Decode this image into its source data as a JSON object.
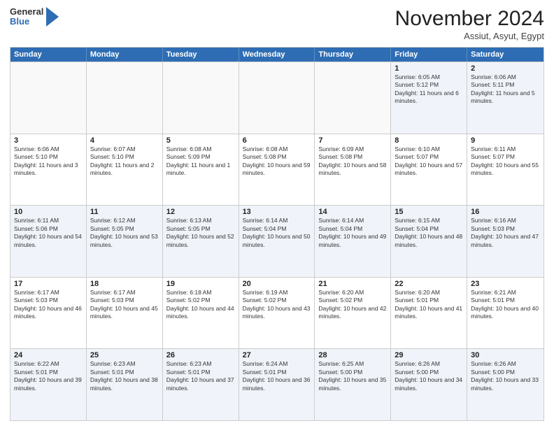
{
  "header": {
    "logo_general": "General",
    "logo_blue": "Blue",
    "month_title": "November 2024",
    "location": "Assiut, Asyut, Egypt"
  },
  "days_of_week": [
    "Sunday",
    "Monday",
    "Tuesday",
    "Wednesday",
    "Thursday",
    "Friday",
    "Saturday"
  ],
  "rows": [
    [
      {
        "day": "",
        "text": "",
        "empty": true
      },
      {
        "day": "",
        "text": "",
        "empty": true
      },
      {
        "day": "",
        "text": "",
        "empty": true
      },
      {
        "day": "",
        "text": "",
        "empty": true
      },
      {
        "day": "",
        "text": "",
        "empty": true
      },
      {
        "day": "1",
        "text": "Sunrise: 6:05 AM\nSunset: 5:12 PM\nDaylight: 11 hours and 6 minutes."
      },
      {
        "day": "2",
        "text": "Sunrise: 6:06 AM\nSunset: 5:11 PM\nDaylight: 11 hours and 5 minutes."
      }
    ],
    [
      {
        "day": "3",
        "text": "Sunrise: 6:06 AM\nSunset: 5:10 PM\nDaylight: 11 hours and 3 minutes."
      },
      {
        "day": "4",
        "text": "Sunrise: 6:07 AM\nSunset: 5:10 PM\nDaylight: 11 hours and 2 minutes."
      },
      {
        "day": "5",
        "text": "Sunrise: 6:08 AM\nSunset: 5:09 PM\nDaylight: 11 hours and 1 minute."
      },
      {
        "day": "6",
        "text": "Sunrise: 6:08 AM\nSunset: 5:08 PM\nDaylight: 10 hours and 59 minutes."
      },
      {
        "day": "7",
        "text": "Sunrise: 6:09 AM\nSunset: 5:08 PM\nDaylight: 10 hours and 58 minutes."
      },
      {
        "day": "8",
        "text": "Sunrise: 6:10 AM\nSunset: 5:07 PM\nDaylight: 10 hours and 57 minutes."
      },
      {
        "day": "9",
        "text": "Sunrise: 6:11 AM\nSunset: 5:07 PM\nDaylight: 10 hours and 55 minutes."
      }
    ],
    [
      {
        "day": "10",
        "text": "Sunrise: 6:11 AM\nSunset: 5:06 PM\nDaylight: 10 hours and 54 minutes."
      },
      {
        "day": "11",
        "text": "Sunrise: 6:12 AM\nSunset: 5:05 PM\nDaylight: 10 hours and 53 minutes."
      },
      {
        "day": "12",
        "text": "Sunrise: 6:13 AM\nSunset: 5:05 PM\nDaylight: 10 hours and 52 minutes."
      },
      {
        "day": "13",
        "text": "Sunrise: 6:14 AM\nSunset: 5:04 PM\nDaylight: 10 hours and 50 minutes."
      },
      {
        "day": "14",
        "text": "Sunrise: 6:14 AM\nSunset: 5:04 PM\nDaylight: 10 hours and 49 minutes."
      },
      {
        "day": "15",
        "text": "Sunrise: 6:15 AM\nSunset: 5:04 PM\nDaylight: 10 hours and 48 minutes."
      },
      {
        "day": "16",
        "text": "Sunrise: 6:16 AM\nSunset: 5:03 PM\nDaylight: 10 hours and 47 minutes."
      }
    ],
    [
      {
        "day": "17",
        "text": "Sunrise: 6:17 AM\nSunset: 5:03 PM\nDaylight: 10 hours and 46 minutes."
      },
      {
        "day": "18",
        "text": "Sunrise: 6:17 AM\nSunset: 5:03 PM\nDaylight: 10 hours and 45 minutes."
      },
      {
        "day": "19",
        "text": "Sunrise: 6:18 AM\nSunset: 5:02 PM\nDaylight: 10 hours and 44 minutes."
      },
      {
        "day": "20",
        "text": "Sunrise: 6:19 AM\nSunset: 5:02 PM\nDaylight: 10 hours and 43 minutes."
      },
      {
        "day": "21",
        "text": "Sunrise: 6:20 AM\nSunset: 5:02 PM\nDaylight: 10 hours and 42 minutes."
      },
      {
        "day": "22",
        "text": "Sunrise: 6:20 AM\nSunset: 5:01 PM\nDaylight: 10 hours and 41 minutes."
      },
      {
        "day": "23",
        "text": "Sunrise: 6:21 AM\nSunset: 5:01 PM\nDaylight: 10 hours and 40 minutes."
      }
    ],
    [
      {
        "day": "24",
        "text": "Sunrise: 6:22 AM\nSunset: 5:01 PM\nDaylight: 10 hours and 39 minutes."
      },
      {
        "day": "25",
        "text": "Sunrise: 6:23 AM\nSunset: 5:01 PM\nDaylight: 10 hours and 38 minutes."
      },
      {
        "day": "26",
        "text": "Sunrise: 6:23 AM\nSunset: 5:01 PM\nDaylight: 10 hours and 37 minutes."
      },
      {
        "day": "27",
        "text": "Sunrise: 6:24 AM\nSunset: 5:01 PM\nDaylight: 10 hours and 36 minutes."
      },
      {
        "day": "28",
        "text": "Sunrise: 6:25 AM\nSunset: 5:00 PM\nDaylight: 10 hours and 35 minutes."
      },
      {
        "day": "29",
        "text": "Sunrise: 6:26 AM\nSunset: 5:00 PM\nDaylight: 10 hours and 34 minutes."
      },
      {
        "day": "30",
        "text": "Sunrise: 6:26 AM\nSunset: 5:00 PM\nDaylight: 10 hours and 33 minutes."
      }
    ]
  ]
}
